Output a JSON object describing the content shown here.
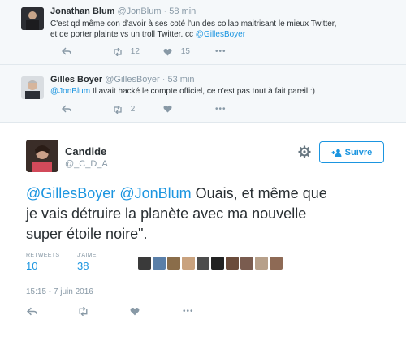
{
  "reply1": {
    "name": "Jonathan Blum",
    "handle": "@JonBlum",
    "dot": "·",
    "time": "58 min",
    "text_line1": "C'est qd même con d'avoir à ses coté l'un des collab maitrisant le mieux Twitter,",
    "text_line2_pre": "et de porter plainte vs un troll Twitter. cc ",
    "text_line2_link": "@GillesBoyer",
    "retweets": "12",
    "likes": "15",
    "more": "•••"
  },
  "reply2": {
    "name": "Gilles Boyer",
    "handle": "@GillesBoyer",
    "dot": "·",
    "time": "53 min",
    "text_link": "@JonBlum",
    "text_rest": " Il avait hacké le compte officiel, ce n'est pas tout à fait pareil :)",
    "retweets": "2",
    "more": "•••"
  },
  "main": {
    "name": "Candide",
    "handle": "@_C_D_A",
    "follow_label": "Suivre",
    "mention1": "@GillesBoyer",
    "mention2": "@JonBlum",
    "text_line1_rest": " Ouais, et même que",
    "text_line2": "je vais détruire la planète avec ma nouvelle",
    "text_line3": "super étoile noire\".",
    "retweets_label": "RETWEETS",
    "retweets_value": "10",
    "likes_label": "J'AIME",
    "likes_value": "38",
    "datetime": "15:15 - 7 juin 2016"
  },
  "likers": [
    "#3a3a3a",
    "#5a7fa8",
    "#8a6d4a",
    "#c9a27e",
    "#4d4d4d",
    "#222222",
    "#6b4c3b",
    "#7a5c4f",
    "#b7a08a",
    "#8e6a55"
  ],
  "colors": {
    "accent": "#1b95e0",
    "muted": "#8899a6",
    "border": "#e1e8ed"
  }
}
